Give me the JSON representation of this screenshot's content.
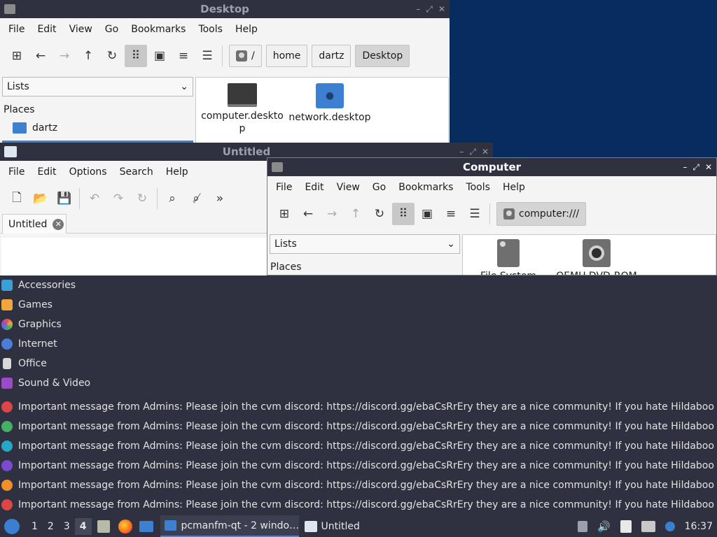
{
  "desktop_window": {
    "title": "Desktop",
    "menus": [
      "File",
      "Edit",
      "View",
      "Go",
      "Bookmarks",
      "Tools",
      "Help"
    ],
    "path": [
      "/",
      "home",
      "dartz",
      "Desktop"
    ],
    "side_combo": "Lists",
    "places_label": "Places",
    "places_item": "dartz",
    "files": [
      {
        "name": "computer.deskto\np",
        "icon": "monitor-icon"
      },
      {
        "name": "network.desktop",
        "icon": "network-folder-icon"
      }
    ]
  },
  "editor_window": {
    "title": "Untitled",
    "menus": [
      "File",
      "Edit",
      "Options",
      "Search",
      "Help"
    ],
    "tab_label": "Untitled"
  },
  "computer_window": {
    "title": "Computer",
    "menus": [
      "File",
      "Edit",
      "View",
      "Go",
      "Bookmarks",
      "Tools",
      "Help"
    ],
    "location": "computer:///",
    "side_combo": "Lists",
    "places_label": "Places",
    "files": [
      {
        "name": "File System",
        "icon": "harddisk-icon"
      },
      {
        "name": "QEMU DVD-ROM",
        "icon": "optical-drive-icon"
      }
    ]
  },
  "app_menu": {
    "categories": [
      {
        "label": "Accessories",
        "color": "#3a9fd6"
      },
      {
        "label": "Games",
        "color": "#f2a53a"
      },
      {
        "label": "Graphics",
        "color": "#e0505a"
      },
      {
        "label": "Internet",
        "color": "#4a7ed9"
      },
      {
        "label": "Office",
        "color": "#d8d8d8"
      },
      {
        "label": "Sound & Video",
        "color": "#9c4ac9"
      }
    ],
    "notifications": [
      {
        "text": "Important message from Admins: Please join the cvm discord: https://discord.gg/ebaCsRrEry they are a nice community! If you hate Hildaboo or any",
        "color": "#e04545"
      },
      {
        "text": "Important message from Admins: Please join the cvm discord: https://discord.gg/ebaCsRrEry they are a nice community! If you hate Hildaboo or any",
        "color": "#44b064"
      },
      {
        "text": "Important message from Admins: Please join the cvm discord: https://discord.gg/ebaCsRrEry they are a nice community! If you hate Hildaboo or any",
        "color": "#25a8c8"
      },
      {
        "text": "Important message from Admins: Please join the cvm discord: https://discord.gg/ebaCsRrEry they are a nice community! If you hate Hildaboo or any",
        "color": "#7a4ad0"
      },
      {
        "text": "Important message from Admins: Please join the cvm discord: https://discord.gg/ebaCsRrEry they are a nice community! If you hate Hildaboo or any",
        "color": "#f0902a"
      },
      {
        "text": "Important message from Admins: Please join the cvm discord: https://discord.gg/ebaCsRrEry they are a nice community! If you hate Hildaboo or any",
        "color": "#e04545"
      }
    ]
  },
  "taskbar": {
    "workspaces": [
      "1",
      "2",
      "3",
      "4"
    ],
    "active_workspace": "4",
    "tasks": [
      {
        "label": "pcmanfm-qt - 2 windo…",
        "icon": "folder-icon"
      },
      {
        "label": "Untitled",
        "icon": "text-editor-icon"
      }
    ],
    "clock": "16:37"
  }
}
